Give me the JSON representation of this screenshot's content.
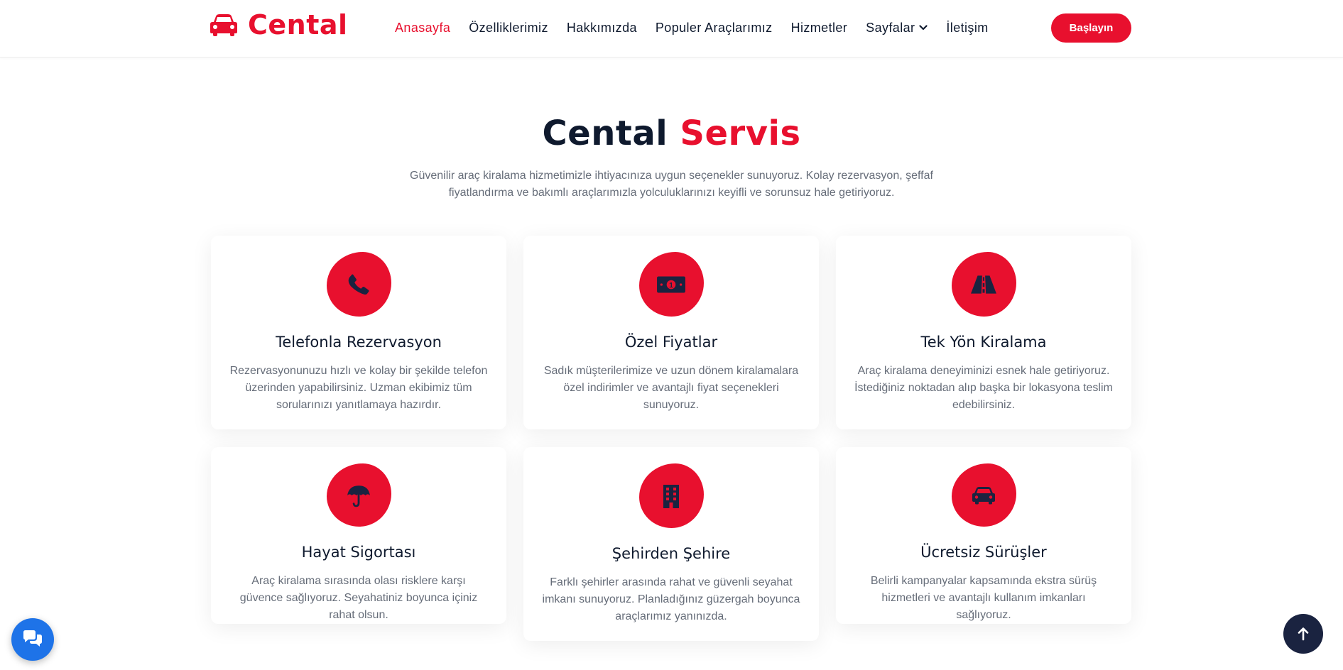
{
  "brand": {
    "name": "Cental",
    "logo_icon": "car-icon",
    "accent_color": "#e8102e",
    "dark_color": "#0f1a2e"
  },
  "nav": {
    "items": [
      {
        "label": "Anasayfa",
        "active": true
      },
      {
        "label": "Özelliklerimiz"
      },
      {
        "label": "Hakkımızda"
      },
      {
        "label": "Populer Araçlarımız"
      },
      {
        "label": "Hizmetler"
      },
      {
        "label": "Sayfalar",
        "icon": "chevron-down-icon"
      },
      {
        "label": "İletişim"
      }
    ],
    "cta_label": "Başlayın"
  },
  "section": {
    "title_part1": "Cental",
    "title_part2": "Servis",
    "description": "Güvenilir araç kiralama hizmetimizle ihtiyacınıza uygun seçenekler sunuyoruz. Kolay rezervasyon, şeffaf fiyatlandırma ve bakımlı araçlarımızla yolculuklarınızı keyifli ve sorunsuz hale getiriyoruz."
  },
  "services": [
    {
      "icon": "phone-icon",
      "title": "Telefonla Rezervasyon",
      "text": "Rezervasyonunuzu hızlı ve kolay bir şekilde telefon üzerinden yapabilirsiniz. Uzman ekibimiz tüm sorularınızı yanıtlamaya hazırdır."
    },
    {
      "icon": "money-bill-icon",
      "title": "Özel Fiyatlar",
      "text": "Sadık müşterilerimize ve uzun dönem kiralamalara özel indirimler ve avantajlı fiyat seçenekleri sunuyoruz."
    },
    {
      "icon": "road-icon",
      "title": "Tek Yön Kiralama",
      "text": "Araç kiralama deneyiminizi esnek hale getiriyoruz. İstediğiniz noktadan alıp başka bir lokasyona teslim edebilirsiniz."
    },
    {
      "icon": "umbrella-icon",
      "title": "Hayat Sigortası",
      "text": "Araç kiralama sırasında olası risklere karşı güvence sağlıyoruz. Seyahatiniz boyunca içiniz rahat olsun."
    },
    {
      "icon": "building-icon",
      "title": "Şehirden Şehire",
      "text": "Farklı şehirler arasında rahat ve güvenli seyahat imkanı sunuyoruz. Planladığınız güzergah boyunca araçlarımız yanınızda."
    },
    {
      "icon": "car-side-icon",
      "title": "Ücretsiz Sürüşler",
      "text": "Belirli kampanyalar kapsamında ekstra sürüş hizmetleri ve avantajlı kullanım imkanları sağlıyoruz."
    }
  ],
  "floating": {
    "chat_icon": "chat-bubbles-icon",
    "back_to_top_icon": "arrow-up-icon"
  }
}
